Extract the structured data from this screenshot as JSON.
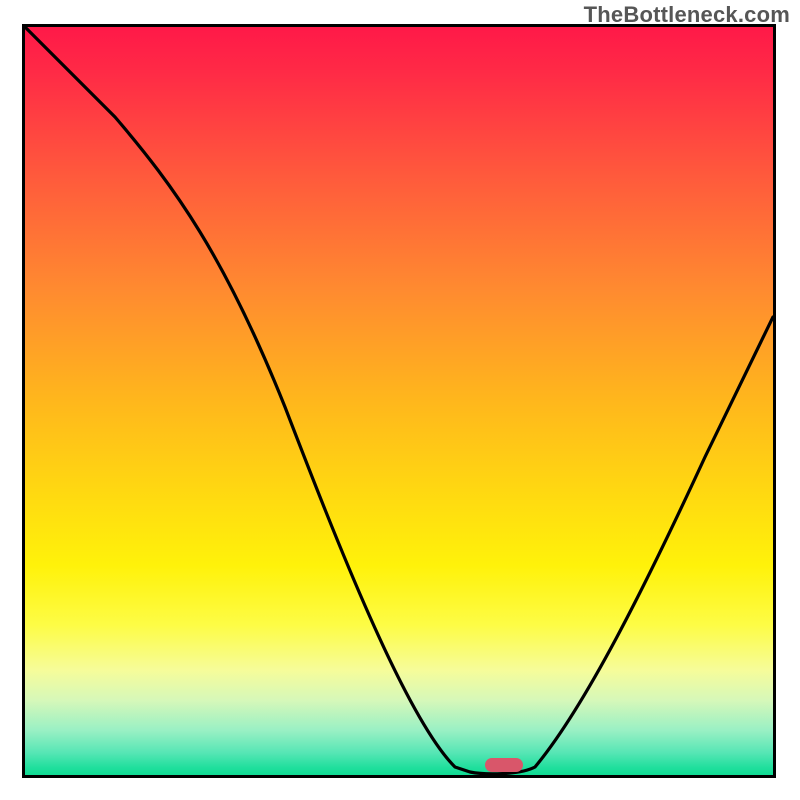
{
  "watermark": "TheBottleneck.com",
  "chart_data": {
    "type": "line",
    "title": "",
    "xlabel": "",
    "ylabel": "",
    "xlim": [
      0,
      100
    ],
    "ylim": [
      0,
      100
    ],
    "grid": false,
    "legend": false,
    "series": [
      {
        "name": "bottleneck-curve",
        "x": [
          0,
          12,
          28,
          45,
          58,
          62,
          66,
          70,
          80,
          90,
          100
        ],
        "y": [
          100,
          88,
          70,
          40,
          10,
          2,
          0,
          2,
          20,
          48,
          66
        ]
      }
    ],
    "marker": {
      "x": 65,
      "y": 0,
      "color": "#d9566a"
    },
    "gradient_stops": [
      {
        "pos": 0,
        "color": "#ff1948"
      },
      {
        "pos": 50,
        "color": "#ffd811"
      },
      {
        "pos": 80,
        "color": "#fdfc46"
      },
      {
        "pos": 100,
        "color": "#10db93"
      }
    ]
  }
}
